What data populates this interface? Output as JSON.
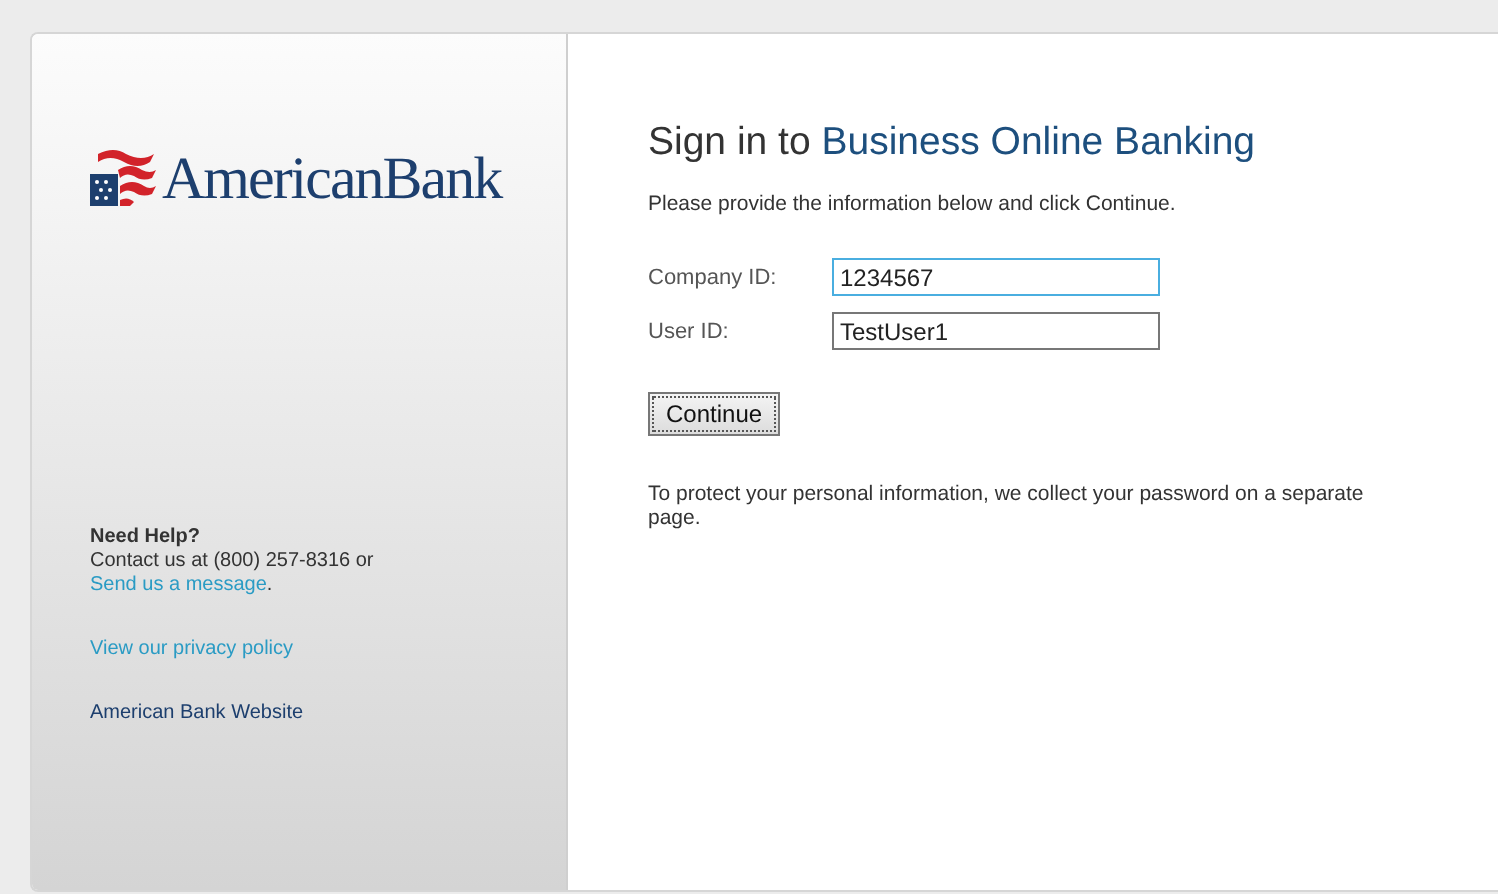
{
  "logo": {
    "name": "AmericanBank"
  },
  "help": {
    "heading": "Need Help?",
    "contact": "Contact us at (800) 257-8316 or",
    "link": "Send us a message",
    "after": "."
  },
  "sidebar_links": [
    {
      "label": "View our privacy policy",
      "kind": "link"
    },
    {
      "label": "American Bank Website",
      "kind": "plain"
    }
  ],
  "title": {
    "lead": "Sign in to",
    "product": "Business Online Banking"
  },
  "instructions": "Please provide the information below and click Continue.",
  "fields": [
    {
      "label": "Company ID:",
      "value": "1234567",
      "focused": true
    },
    {
      "label": "User ID:",
      "value": "TestUser1",
      "focused": false
    }
  ],
  "button": "Continue",
  "notice": "To protect your personal information, we collect your password on a separate page."
}
